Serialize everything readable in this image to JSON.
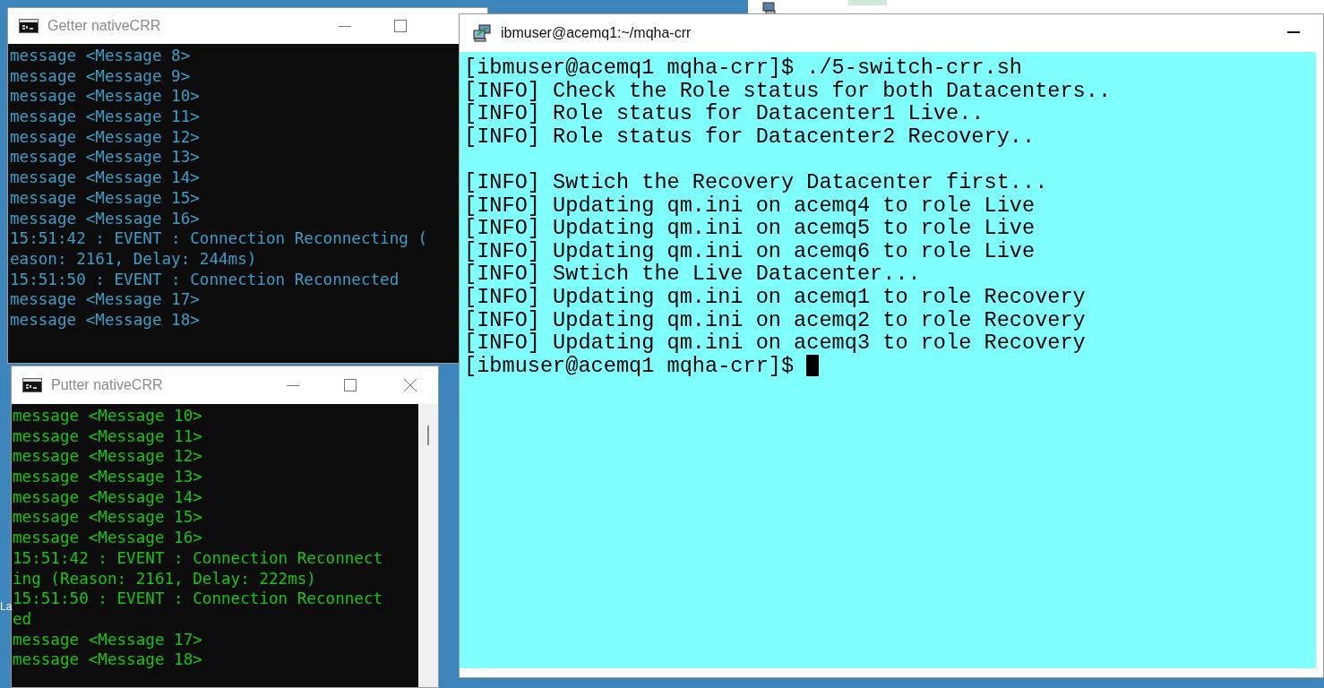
{
  "desktop": {
    "label": "La"
  },
  "windows": [
    {
      "kind": "console",
      "title": "Getter nativeCRR",
      "color": "#3a9fc8",
      "lines": [
        "message <Message 8>",
        "message <Message 9>",
        "message <Message 10>",
        "message <Message 11>",
        "message <Message 12>",
        "message <Message 13>",
        "message <Message 14>",
        "message <Message 15>",
        "message <Message 16>",
        "15:51:42 : EVENT : Connection Reconnecting (",
        "eason: 2161, Delay: 244ms)",
        "15:51:50 : EVENT : Connection Reconnected",
        "message <Message 17>",
        "message <Message 18>"
      ]
    },
    {
      "kind": "console",
      "title": "Putter nativeCRR",
      "color": "#16c60c",
      "lines": [
        "message <Message 10>",
        "message <Message 11>",
        "message <Message 12>",
        "message <Message 13>",
        "message <Message 14>",
        "message <Message 15>",
        "message <Message 16>",
        "15:51:42 : EVENT : Connection Reconnect",
        "ing (Reason: 2161, Delay: 222ms)",
        "15:51:50 : EVENT : Connection Reconnect",
        "ed",
        "message <Message 17>",
        "message <Message 18>"
      ]
    },
    {
      "kind": "putty",
      "title": "ibmuser@acemq1:~/mqha-crr",
      "color": "#000000",
      "cursor_visible": true,
      "lines": [
        "[ibmuser@acemq1 mqha-crr]$ ./5-switch-crr.sh",
        "[INFO] Check the Role status for both Datacenters..",
        "[INFO] Role status for Datacenter1 Live..",
        "[INFO] Role status for Datacenter2 Recovery.."
      ],
      "lines_after_gap": [
        "[INFO] Swtich the Recovery Datacenter first...",
        "[INFO] Updating qm.ini on acemq4 to role Live",
        "[INFO] Updating qm.ini on acemq5 to role Live",
        "[INFO] Updating qm.ini on acemq6 to role Live",
        "[INFO] Swtich the Live Datacenter...",
        "[INFO] Updating qm.ini on acemq1 to role Recovery",
        "[INFO] Updating qm.ini on acemq2 to role Recovery",
        "[INFO] Updating qm.ini on acemq3 to role Recovery",
        "[ibmuser@acemq1 mqha-crr]$ "
      ]
    }
  ]
}
